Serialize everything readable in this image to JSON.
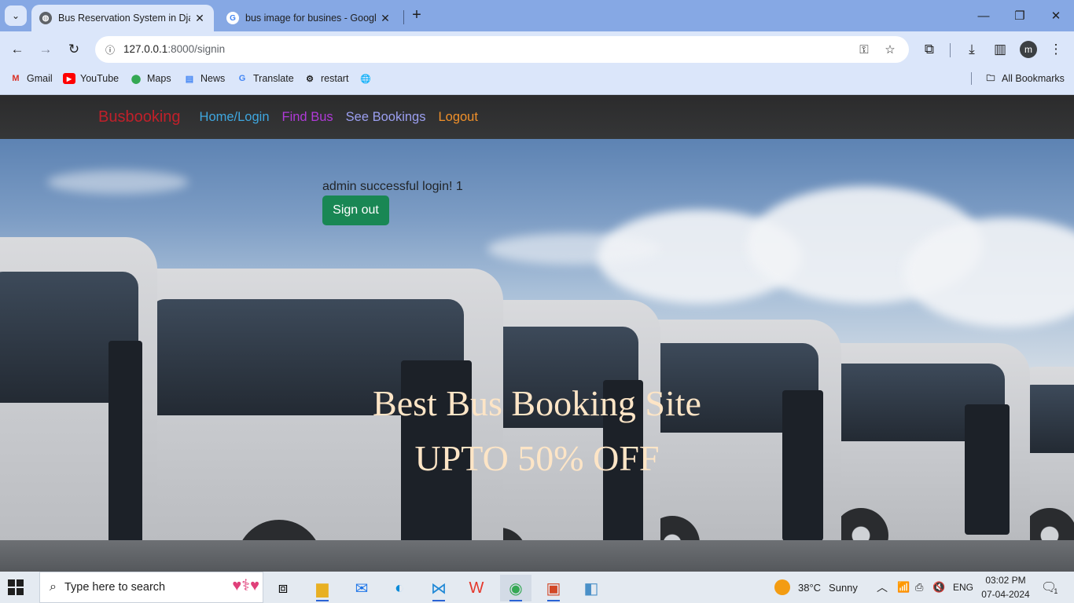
{
  "browser": {
    "tabs": [
      {
        "title": "Bus Reservation System in Djan",
        "active": true
      },
      {
        "title": "bus image for busines - Google",
        "active": false
      }
    ],
    "url_host": "127.0.0.1",
    "url_path": ":8000/signin",
    "bookmarks": [
      {
        "label": "Gmail",
        "icon": "gmail-icon"
      },
      {
        "label": "YouTube",
        "icon": "youtube-icon"
      },
      {
        "label": "Maps",
        "icon": "maps-icon"
      },
      {
        "label": "News",
        "icon": "news-icon"
      },
      {
        "label": "Translate",
        "icon": "translate-icon"
      },
      {
        "label": "restart",
        "icon": "gear-icon"
      }
    ],
    "all_bookmarks": "All Bookmarks",
    "profile_initial": "m"
  },
  "navbar": {
    "brand": "Busbooking",
    "brand_color": "#c0202a",
    "links": [
      {
        "label": "Home/Login",
        "color": "#3fa7e0"
      },
      {
        "label": "Find Bus",
        "color": "#b03ad8"
      },
      {
        "label": "See Bookings",
        "color": "#9b9ff0"
      },
      {
        "label": "Logout",
        "color": "#f0902a"
      }
    ]
  },
  "hero": {
    "message": "admin successful login! 1",
    "signout_label": "Sign out",
    "headline": "Best Bus Booking Site",
    "subheadline": "UPTO 50% OFF"
  },
  "taskbar": {
    "search_placeholder": "Type here to search",
    "weather_temp": "38°C",
    "weather_text": "Sunny",
    "language": "ENG",
    "time": "03:02 PM",
    "date": "07-04-2024",
    "notification_count": "1"
  }
}
